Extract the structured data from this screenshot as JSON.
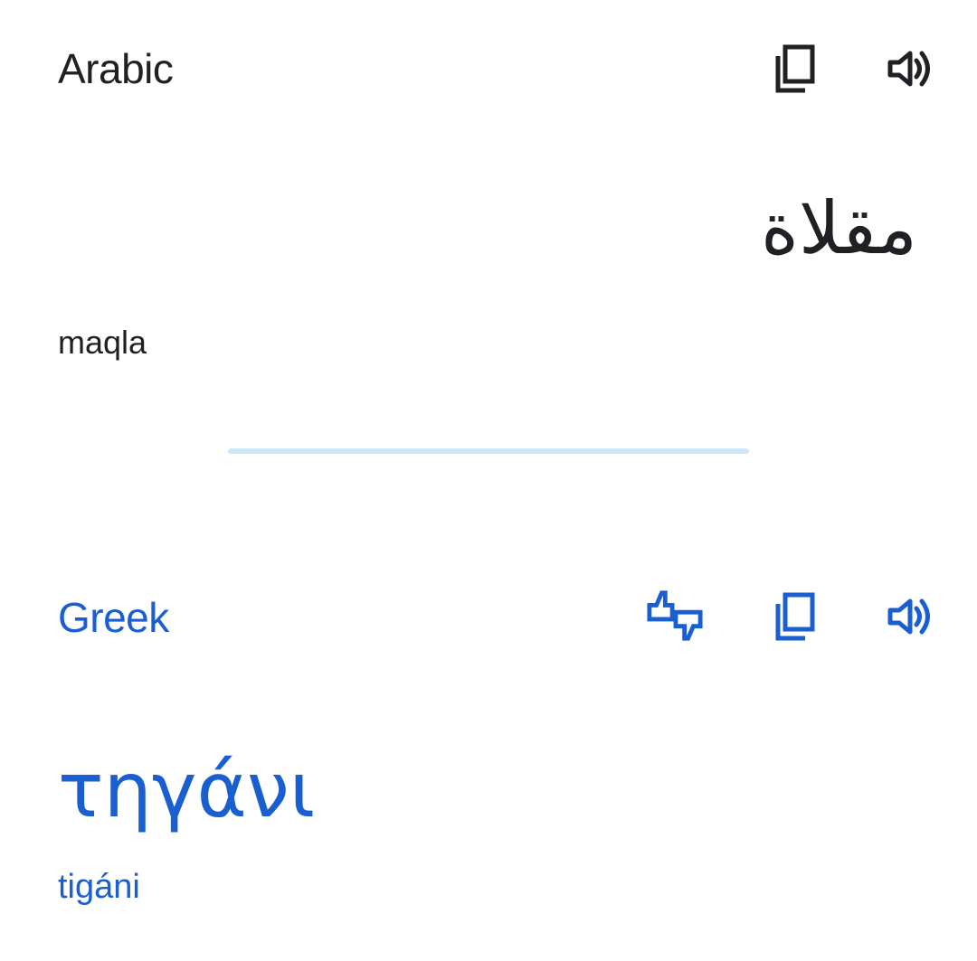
{
  "source": {
    "language": "Arabic",
    "text": "مقلاة",
    "transliteration": "maqla",
    "actions": [
      {
        "icon": "copy-icon"
      },
      {
        "icon": "speaker-icon"
      }
    ]
  },
  "target": {
    "language": "Greek",
    "text": "τηγάνι",
    "transliteration": "tigáni",
    "actions": [
      {
        "icon": "rate-translation-icon"
      },
      {
        "icon": "copy-icon"
      },
      {
        "icon": "speaker-icon"
      }
    ]
  },
  "colors": {
    "source_text": "#202124",
    "accent": "#1a5fd1",
    "divider": "#cfe6f7"
  }
}
